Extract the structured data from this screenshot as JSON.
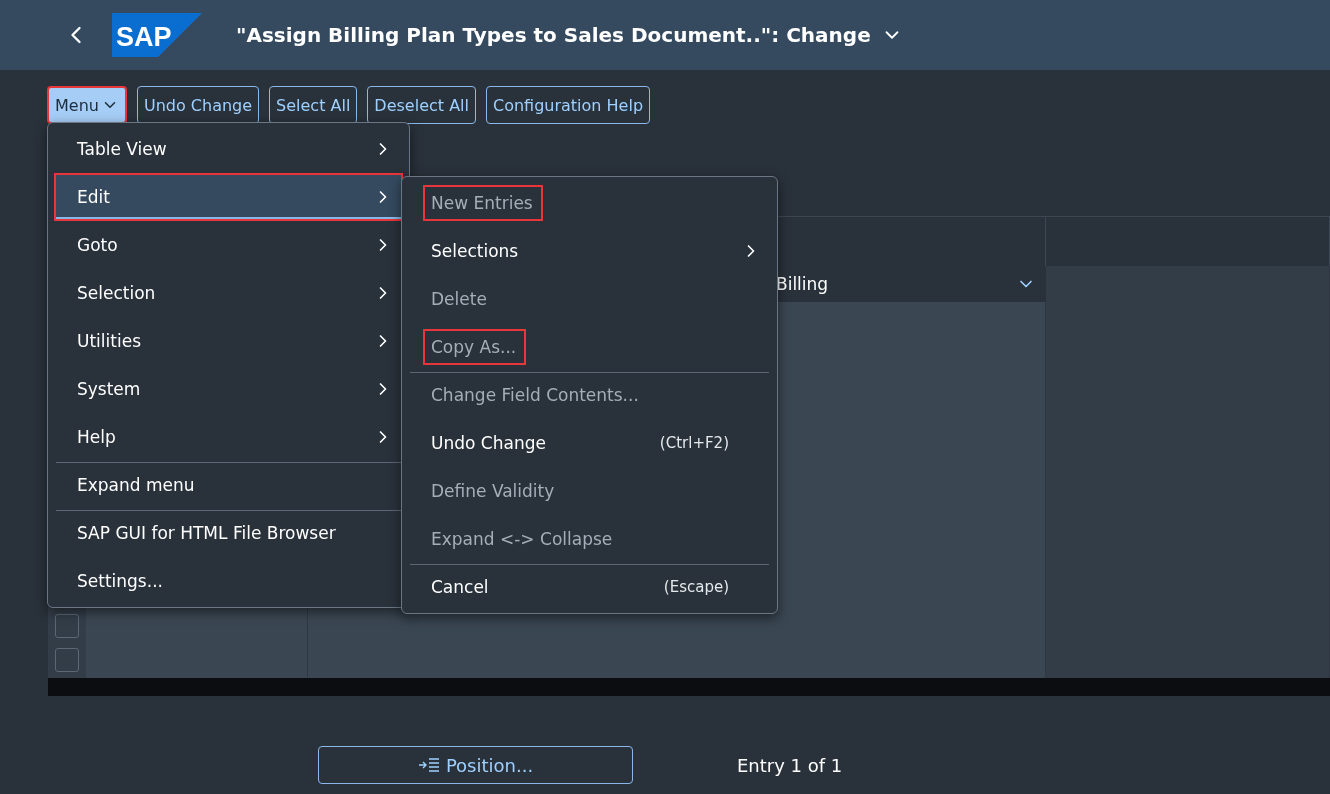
{
  "header": {
    "logo_text": "SAP",
    "title": "\"Assign Billing Plan Types to Sales Document..\": Change"
  },
  "toolbar": [
    {
      "label": "Menu",
      "kind": "menu",
      "highlighted": true
    },
    {
      "label": "Undo Change",
      "kind": "button",
      "highlighted": false
    },
    {
      "label": "Select All",
      "kind": "button",
      "highlighted": false
    },
    {
      "label": "Deselect All",
      "kind": "button",
      "highlighted": false
    },
    {
      "label": "Configuration Help",
      "kind": "button",
      "highlighted": false
    }
  ],
  "menu": [
    {
      "label": "Table View",
      "submenu": true,
      "selected": false,
      "highlighted": false,
      "separator_before": false
    },
    {
      "label": "Edit",
      "submenu": true,
      "selected": true,
      "highlighted": true,
      "separator_before": false
    },
    {
      "label": "Goto",
      "submenu": true,
      "selected": false,
      "highlighted": false,
      "separator_before": false
    },
    {
      "label": "Selection",
      "submenu": true,
      "selected": false,
      "highlighted": false,
      "separator_before": false
    },
    {
      "label": "Utilities",
      "submenu": true,
      "selected": false,
      "highlighted": false,
      "separator_before": false
    },
    {
      "label": "System",
      "submenu": true,
      "selected": false,
      "highlighted": false,
      "separator_before": false
    },
    {
      "label": "Help",
      "submenu": true,
      "selected": false,
      "highlighted": false,
      "separator_before": false
    },
    {
      "label": "Expand menu",
      "submenu": false,
      "selected": false,
      "highlighted": false,
      "separator_before": true
    },
    {
      "label": "SAP GUI for HTML File Browser",
      "submenu": false,
      "selected": false,
      "highlighted": false,
      "separator_before": true
    },
    {
      "label": "Settings...",
      "submenu": false,
      "selected": false,
      "highlighted": false,
      "separator_before": false
    }
  ],
  "submenu": [
    {
      "label": "New Entries",
      "disabled": true,
      "submenu": false,
      "highlighted": true,
      "separator_before": false
    },
    {
      "label": "Selections",
      "disabled": false,
      "submenu": true,
      "highlighted": false,
      "separator_before": false
    },
    {
      "label": "Delete",
      "disabled": true,
      "submenu": false,
      "highlighted": false,
      "separator_before": false
    },
    {
      "label": "Copy As...",
      "disabled": true,
      "submenu": false,
      "highlighted": true,
      "separator_before": false
    },
    {
      "label": "Change Field Contents...",
      "disabled": true,
      "submenu": false,
      "highlighted": false,
      "separator_before": true
    },
    {
      "label": "Undo Change",
      "shortcut": "(Ctrl+F2)",
      "disabled": false,
      "submenu": false,
      "highlighted": false,
      "separator_before": false
    },
    {
      "label": "Define Validity",
      "disabled": true,
      "submenu": false,
      "highlighted": false,
      "separator_before": false
    },
    {
      "label": "Expand <-> Collapse",
      "disabled": true,
      "submenu": false,
      "highlighted": false,
      "separator_before": false
    },
    {
      "label": "Cancel",
      "shortcut": "(Escape)",
      "disabled": false,
      "submenu": false,
      "highlighted": false,
      "separator_before": true
    }
  ],
  "table": {
    "cell_value": "Billing",
    "row_selectors": [
      {
        "checked": false
      },
      {
        "checked": false
      }
    ]
  },
  "footer": {
    "position_button": "Position...",
    "entry_info": "Entry 1 of 1"
  }
}
